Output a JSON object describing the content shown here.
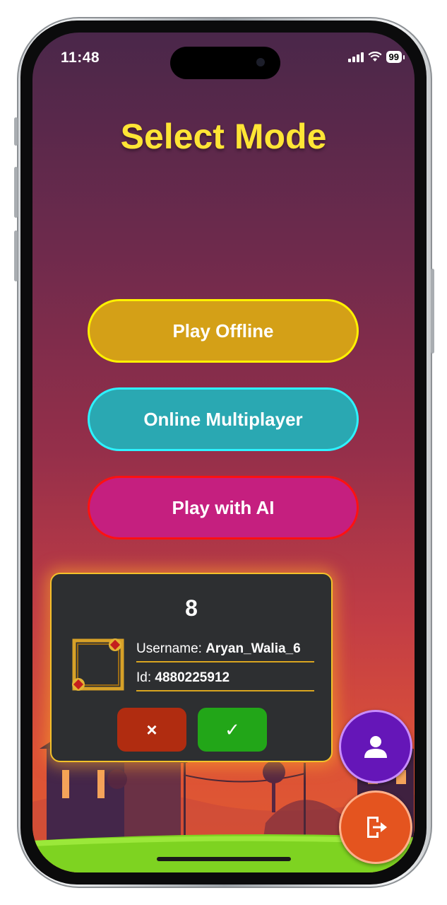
{
  "status_bar": {
    "time": "11:48",
    "battery": "99"
  },
  "screen": {
    "title": "Select Mode",
    "buttons": {
      "offline": "Play Offline",
      "online": "Online Multiplayer",
      "ai": "Play with AI"
    }
  },
  "dialog": {
    "number": "8",
    "username_label": "Username: ",
    "username": "Aryan_Walia_6",
    "id_label": "Id: ",
    "id": "4880225912",
    "cancel_label": "×",
    "confirm_label": "✓"
  },
  "fabs": {
    "profile_icon": "user-icon",
    "exit_icon": "logout-icon"
  },
  "colors": {
    "title": "#ffe535",
    "offline": "#d4a017",
    "online": "#2aa8b2",
    "ai": "#c51f7f",
    "cancel": "#b02c10",
    "confirm": "#22a618",
    "profile_fab": "#6516b8",
    "exit_fab": "#e4541f"
  }
}
